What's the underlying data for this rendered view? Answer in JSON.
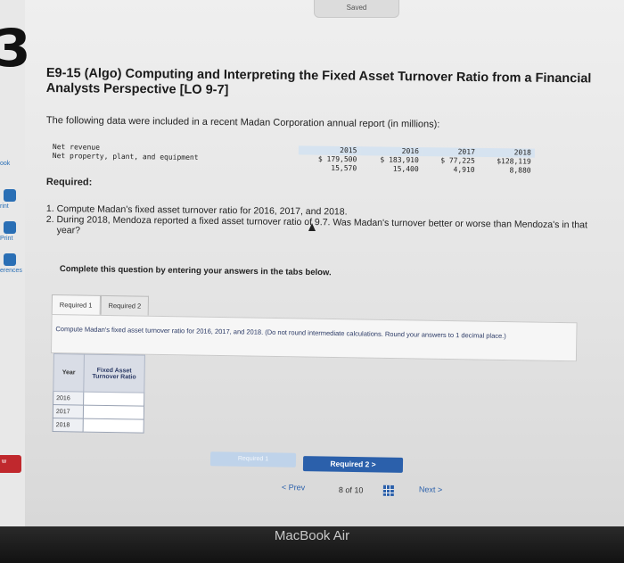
{
  "status": {
    "saved": "Saved"
  },
  "sidebar": {
    "chapter_number": "3",
    "items": [
      {
        "label": "ook"
      },
      {
        "label": "rint"
      },
      {
        "label": "Print"
      },
      {
        "label": "erences"
      }
    ],
    "badge": "w"
  },
  "problem": {
    "title": "E9-15 (Algo) Computing and Interpreting the Fixed Asset Turnover Ratio from a Financial Analysts Perspective [LO 9-7]",
    "intro": "The following data were included in a recent Madan Corporation annual report (in millions):",
    "table": {
      "years": [
        "2015",
        "2016",
        "2017",
        "2018"
      ],
      "rows": [
        {
          "label": "Net revenue",
          "values": [
            "$ 179,500",
            "$ 183,910",
            "$ 77,225",
            "$128,119"
          ]
        },
        {
          "label": "Net property, plant, and equipment",
          "values": [
            "15,570",
            "15,400",
            "4,910",
            "8,880"
          ]
        }
      ]
    },
    "required_label": "Required:",
    "questions": [
      "1. Compute Madan's fixed asset turnover ratio for 2016, 2017, and 2018.",
      "2. During 2018, Mendoza reported a fixed asset turnover ratio of 9.7. Was Madan's turnover better or worse than Mendoza's in that",
      "year?"
    ]
  },
  "answer": {
    "complete_note": "Complete this question by entering your answers in the tabs below.",
    "tabs": [
      {
        "label": "Required 1"
      },
      {
        "label": "Required 2"
      }
    ],
    "instruction": "Compute Madan's fixed asset turnover ratio for 2016, 2017, and 2018. (Do not round intermediate calculations. Round your answers to 1 decimal place.)",
    "table": {
      "col_year": "Year",
      "col_ratio": "Fixed Asset Turnover Ratio",
      "rows": [
        {
          "year": "2016",
          "value": ""
        },
        {
          "year": "2017",
          "value": ""
        },
        {
          "year": "2018",
          "value": ""
        }
      ]
    },
    "prev_button": "Required 1",
    "next_button": "Required 2  >"
  },
  "navigation": {
    "prev": "< Prev",
    "page": "8 of 10",
    "next": "Next >"
  },
  "device": {
    "brand": "MacBook Air"
  }
}
